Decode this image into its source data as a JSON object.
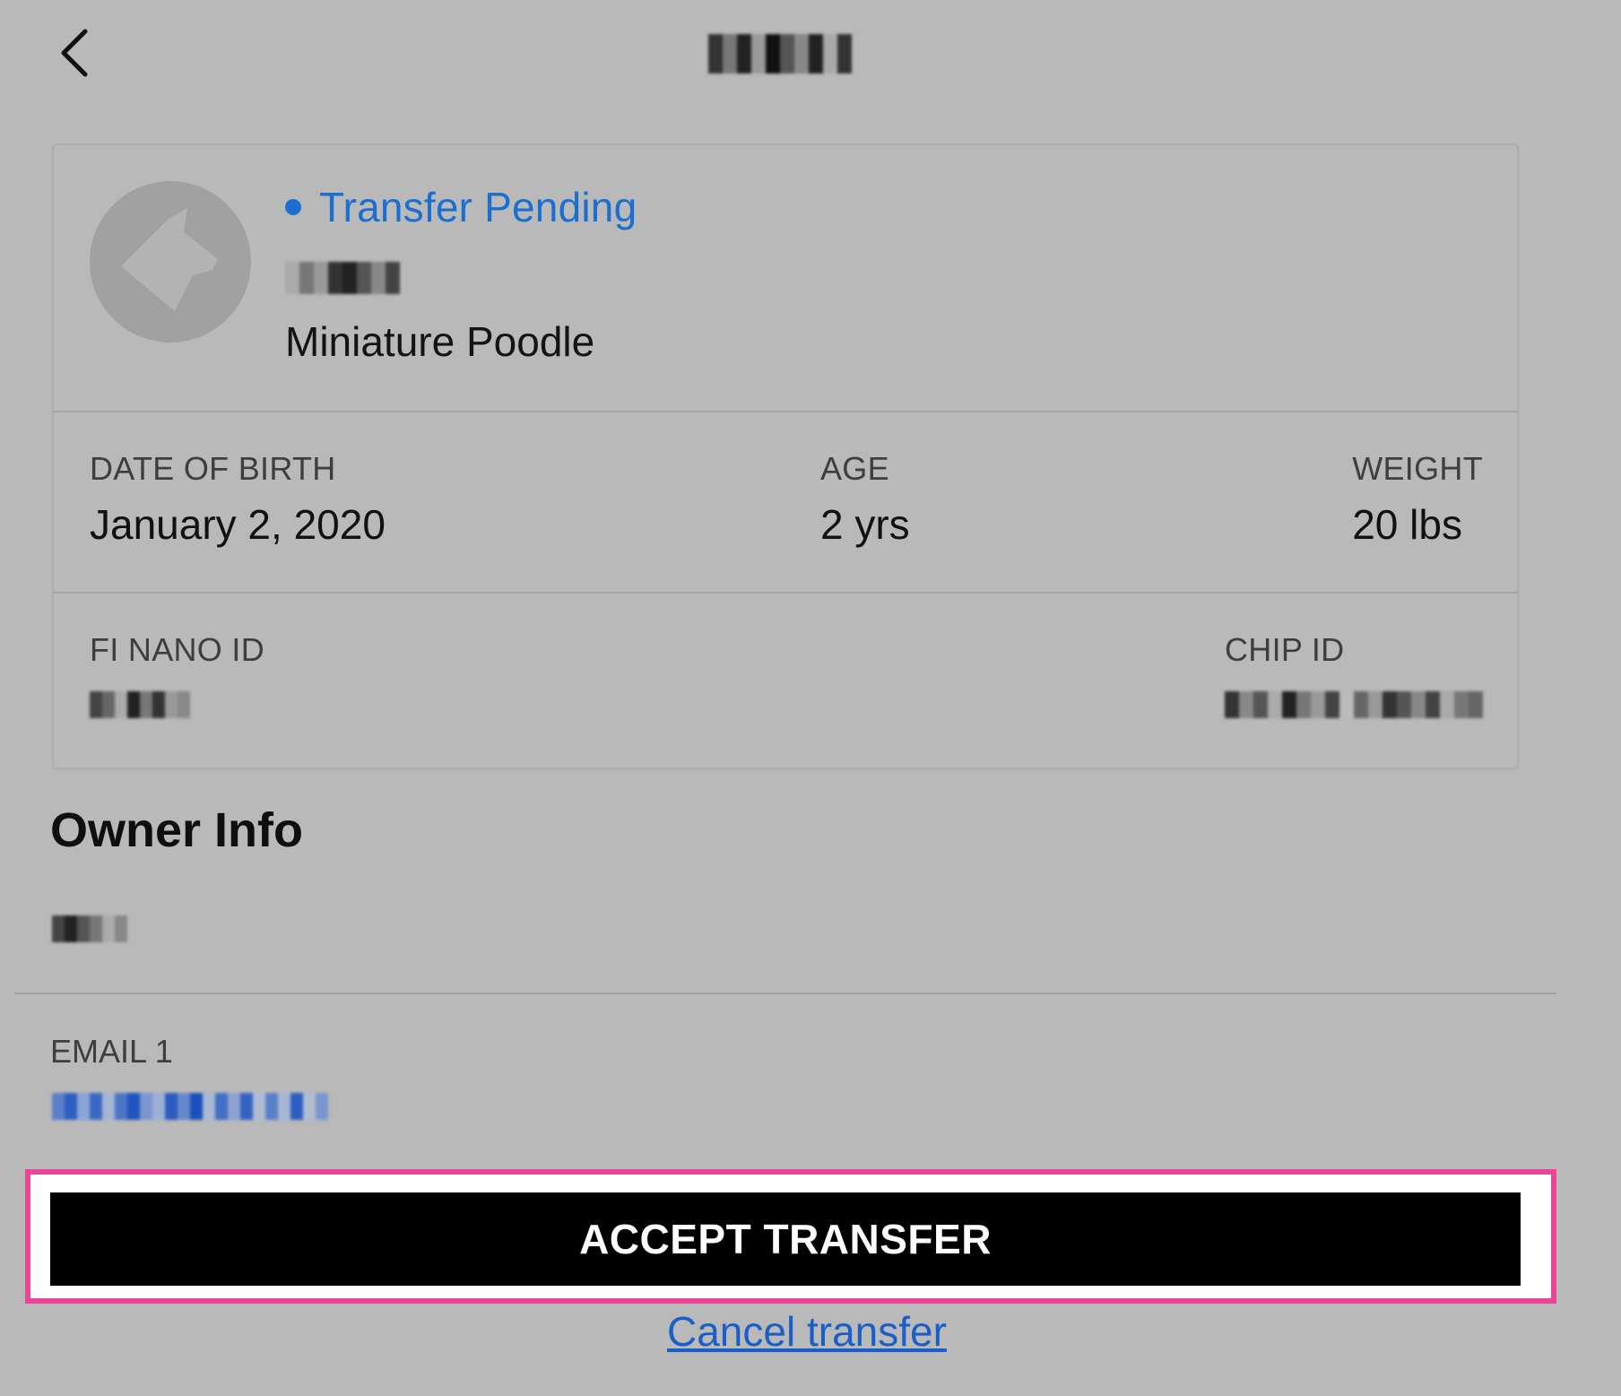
{
  "header": {
    "back_icon": "chevron-left-icon",
    "title_masked": true
  },
  "pet": {
    "status": "Transfer Pending",
    "status_color": "#1a6fd0",
    "name_masked": true,
    "breed": "Miniature Poodle",
    "avatar_icon": "dog-icon",
    "stats": {
      "dob_label": "DATE OF BIRTH",
      "dob_value": "January 2, 2020",
      "age_label": "AGE",
      "age_value": "2 yrs",
      "weight_label": "WEIGHT",
      "weight_value": "20 lbs"
    },
    "ids": {
      "nano_label": "FI NANO ID",
      "chip_label": "CHIP ID"
    }
  },
  "owner": {
    "title": "Owner Info",
    "email_label": "EMAIL 1"
  },
  "actions": {
    "accept_label": "ACCEPT TRANSFER",
    "cancel_label": "Cancel transfer",
    "highlight_color": "#ec4497"
  }
}
